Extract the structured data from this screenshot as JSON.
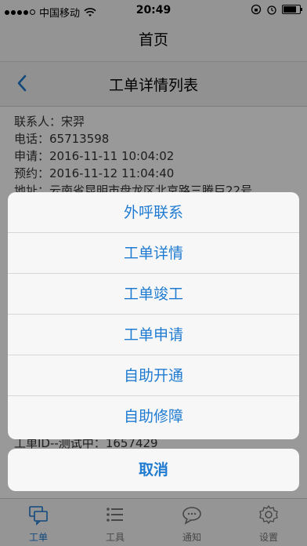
{
  "status_bar": {
    "carrier": "中国移动",
    "time": "20:49",
    "signal_filled": 4,
    "signal_total": 5,
    "battery_level": 0.9,
    "icons": [
      "wifi-icon",
      "orientation-lock-icon",
      "alarm-icon",
      "battery-icon"
    ]
  },
  "app_title": "首页",
  "sub_header": {
    "title": "工单详情列表",
    "back_icon": "chevron-left-icon"
  },
  "detail": {
    "contact": "联系人：宋羿",
    "phone": "电话：65713598",
    "apply": "申请：2016-11-11 10:04:02",
    "reserve": "预约：2016-11-12 11:04:40",
    "address": "地址：云南省昆明市盘龙区北京路三腾巨22号",
    "order_id": "工单ID--测试中：1657429"
  },
  "action_sheet": {
    "items": [
      "外呼联系",
      "工单详情",
      "工单竣工",
      "工单申请",
      "自助开通",
      "自助修障"
    ],
    "cancel": "取消"
  },
  "tabbar": {
    "tabs": [
      {
        "label": "工单",
        "icon": "chat-bubbles-icon",
        "active": true
      },
      {
        "label": "工具",
        "icon": "list-icon",
        "active": false
      },
      {
        "label": "通知",
        "icon": "chat-icon",
        "active": false
      },
      {
        "label": "设置",
        "icon": "gear-icon",
        "active": false
      }
    ]
  },
  "colors": {
    "accent": "#1f7bd1",
    "overlay": "rgba(0,0,0,0.40)"
  }
}
